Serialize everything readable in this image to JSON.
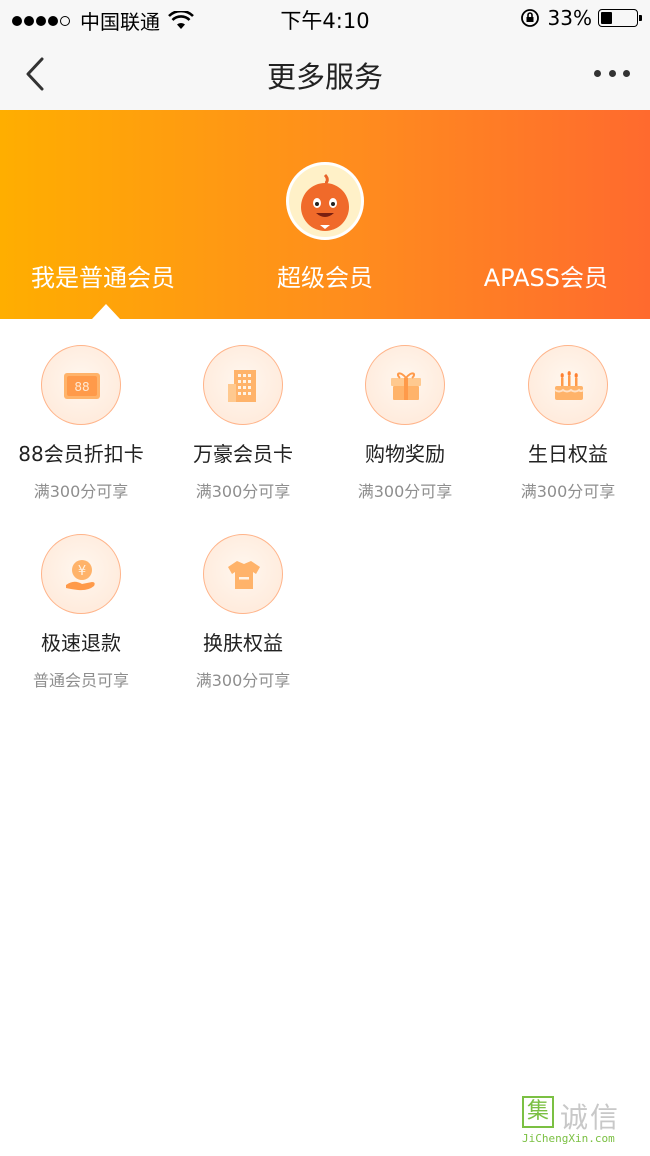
{
  "status_bar": {
    "carrier": "中国联通",
    "time": "下午4:10",
    "battery_percent": "33%",
    "battery_level": 0.33
  },
  "nav": {
    "title": "更多服务",
    "back_icon": "chevron-left-icon",
    "more_icon": "more-dots-icon"
  },
  "banner": {
    "tabs": [
      {
        "label": "我是普通会员",
        "active": true
      },
      {
        "label": "超级会员",
        "active": false
      },
      {
        "label": "APASS会员",
        "active": false
      }
    ],
    "gradient_colors": [
      "#ffae00",
      "#ff6a2e"
    ]
  },
  "services": [
    {
      "icon": "discount-card-icon",
      "label": "88会员折扣卡",
      "sub": "满300分可享",
      "icon_text": "88"
    },
    {
      "icon": "building-icon",
      "label": "万豪会员卡",
      "sub": "满300分可享"
    },
    {
      "icon": "gift-icon",
      "label": "购物奖励",
      "sub": "满300分可享"
    },
    {
      "icon": "birthday-cake-icon",
      "label": "生日权益",
      "sub": "满300分可享"
    },
    {
      "icon": "yen-refund-icon",
      "label": "极速退款",
      "sub": "普通会员可享",
      "icon_text": "¥"
    },
    {
      "icon": "tshirt-icon",
      "label": "换肤权益",
      "sub": "满300分可享"
    }
  ],
  "colors": {
    "accent": "#ff8c1e",
    "icon_border": "#ffb48a",
    "icon_fill": "#ffb36a",
    "subtext": "#8e8e8e"
  },
  "watermark": {
    "box_char": "集",
    "text": "诚信",
    "sub": "JiChengXin.com"
  }
}
